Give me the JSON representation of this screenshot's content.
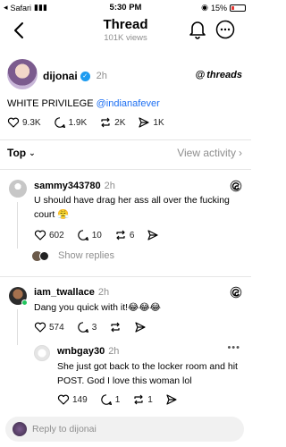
{
  "status": {
    "carrier": "Safari",
    "time": "5:30 PM",
    "battery": "15%"
  },
  "nav": {
    "title": "Thread",
    "views": "101K views"
  },
  "post": {
    "username": "dijonai",
    "time": "2h",
    "brand": "threads",
    "text": "WHITE PRIVILEGE",
    "mention": "@indianafever",
    "likes": "9.3K",
    "comments": "1.9K",
    "reposts": "2K",
    "shares": "1K"
  },
  "sort": {
    "top_label": "Top",
    "activity_label": "View activity"
  },
  "replies": [
    {
      "username": "sammy343780",
      "time": "2h",
      "text": "U should have drag her ass all over the fucking court 😤",
      "likes": "602",
      "comments": "10",
      "reposts": "6",
      "show_replies": "Show replies"
    },
    {
      "username": "iam_twallace",
      "time": "2h",
      "text": "Dang you quick with it!😂😂😂",
      "likes": "574",
      "comments": "3"
    },
    {
      "username": "wnbgay30",
      "time": "2h",
      "text": "She just got back to the locker room and hit POST. God I love this woman lol",
      "likes": "149",
      "comments": "1",
      "reposts": "1"
    }
  ],
  "reply_box": {
    "placeholder": "Reply to dijonai"
  },
  "colors": {
    "accent_blue": "#1d6ff2",
    "muted": "#8e8e8e",
    "verified": "#1d9bf0"
  }
}
